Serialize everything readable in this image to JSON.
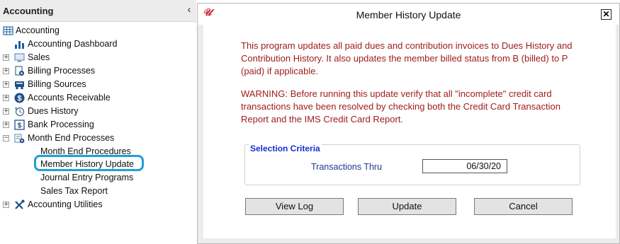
{
  "nav": {
    "title": "Accounting",
    "collapse_glyph": "‹",
    "items": [
      {
        "label": "Accounting",
        "icon": "table-grid-icon",
        "expander": ""
      },
      {
        "label": "Accounting Dashboard",
        "icon": "bar-chart-icon",
        "expander": ""
      },
      {
        "label": "Sales",
        "icon": "monitor-icon",
        "expander": "+"
      },
      {
        "label": "Billing Processes",
        "icon": "billing-gear-icon",
        "expander": "+"
      },
      {
        "label": "Billing Sources",
        "icon": "billing-sources-icon",
        "expander": "+"
      },
      {
        "label": "Accounts Receivable",
        "icon": "dollar-circle-icon",
        "expander": "+"
      },
      {
        "label": "Dues History",
        "icon": "history-icon",
        "expander": "+"
      },
      {
        "label": "Bank Processing",
        "icon": "bank-icon",
        "expander": "+"
      },
      {
        "label": "Month End Processes",
        "icon": "month-end-icon",
        "expander": "−"
      },
      {
        "label": "Month End Procedures",
        "icon": "",
        "expander": ""
      },
      {
        "label": "Member History Update",
        "icon": "",
        "expander": "",
        "selected": true
      },
      {
        "label": "Journal Entry Programs",
        "icon": "",
        "expander": ""
      },
      {
        "label": "Sales Tax Report",
        "icon": "",
        "expander": ""
      },
      {
        "label": "Accounting Utilities",
        "icon": "tools-icon",
        "expander": "+"
      }
    ]
  },
  "dialog": {
    "logo": "𝒰",
    "title": "Member History Update",
    "close_glyph": "✕",
    "message1": "This program updates all paid dues and contribution invoices to Dues History and Contribution History.  It also updates the member billed status from B (billed) to P (paid) if applicable.",
    "message2": "WARNING:  Before running this update verify that all \"incomplete\" credit card transactions have been resolved by checking both the Credit Card Transaction Report and the IMS Credit Card Report.",
    "criteria": {
      "legend": "Selection Criteria",
      "label": "Transactions Thru",
      "value": "06/30/20"
    },
    "buttons": {
      "view_log": "View Log",
      "update": "Update",
      "cancel": "Cancel"
    }
  },
  "colors": {
    "message": "#9e1a1a",
    "legend": "#1a2fd0",
    "selection_ring": "#1ea0d8"
  }
}
